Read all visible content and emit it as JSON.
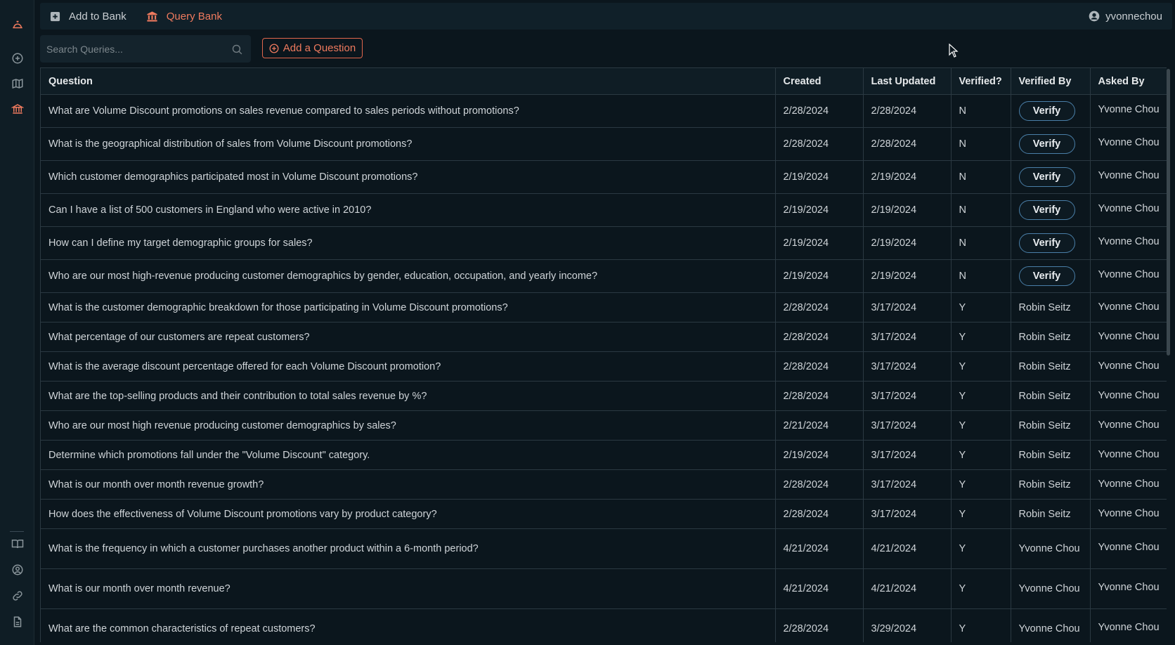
{
  "sidebar": {
    "icons": [
      "logo-icon",
      "plus-circle-icon",
      "map-icon",
      "bank-icon",
      "book-icon",
      "user-circle-icon",
      "link-icon",
      "document-icon"
    ]
  },
  "topbar": {
    "add_to_bank": "Add to Bank",
    "query_bank": "Query Bank",
    "username": "yvonnechou"
  },
  "search": {
    "placeholder": "Search Queries..."
  },
  "add_question_label": "Add a Question",
  "colors": {
    "accent": "#ef7a5e",
    "verify_border": "#4a7fa8",
    "background": "#0b161d"
  },
  "table": {
    "headers": {
      "question": "Question",
      "created": "Created",
      "last_updated": "Last Updated",
      "verified": "Verified?",
      "verified_by": "Verified By",
      "asked_by": "Asked By"
    },
    "verify_label": "Verify",
    "rows": [
      {
        "question": "What are Volume Discount promotions on sales revenue compared to sales periods without promotions?",
        "created": "2/28/2024",
        "last_updated": "2/28/2024",
        "verified": "N",
        "verified_by": "",
        "asked_by": "Yvonne Chou"
      },
      {
        "question": "What is the geographical distribution of sales from Volume Discount promotions?",
        "created": "2/28/2024",
        "last_updated": "2/28/2024",
        "verified": "N",
        "verified_by": "",
        "asked_by": "Yvonne Chou"
      },
      {
        "question": "Which customer demographics participated most in Volume Discount promotions?",
        "created": "2/19/2024",
        "last_updated": "2/19/2024",
        "verified": "N",
        "verified_by": "",
        "asked_by": "Yvonne Chou"
      },
      {
        "question": "Can I have a list of 500 customers in England who were active in 2010?",
        "created": "2/19/2024",
        "last_updated": "2/19/2024",
        "verified": "N",
        "verified_by": "",
        "asked_by": "Yvonne Chou"
      },
      {
        "question": "How can I define my target demographic groups for sales?",
        "created": "2/19/2024",
        "last_updated": "2/19/2024",
        "verified": "N",
        "verified_by": "",
        "asked_by": "Yvonne Chou"
      },
      {
        "question": "Who are our most high-revenue producing customer demographics by gender, education, occupation, and yearly income?",
        "created": "2/19/2024",
        "last_updated": "2/19/2024",
        "verified": "N",
        "verified_by": "",
        "asked_by": "Yvonne Chou"
      },
      {
        "question": "What is the customer demographic breakdown for those participating in Volume Discount promotions?",
        "created": "2/28/2024",
        "last_updated": "3/17/2024",
        "verified": "Y",
        "verified_by": "Robin Seitz",
        "asked_by": "Yvonne Chou"
      },
      {
        "question": "What percentage of our customers are repeat customers?",
        "created": "2/28/2024",
        "last_updated": "3/17/2024",
        "verified": "Y",
        "verified_by": "Robin Seitz",
        "asked_by": "Yvonne Chou"
      },
      {
        "question": "What is the average discount percentage offered for each Volume Discount promotion?",
        "created": "2/28/2024",
        "last_updated": "3/17/2024",
        "verified": "Y",
        "verified_by": "Robin Seitz",
        "asked_by": "Yvonne Chou"
      },
      {
        "question": "What are the top-selling products and their contribution to total sales revenue by %?",
        "created": "2/28/2024",
        "last_updated": "3/17/2024",
        "verified": "Y",
        "verified_by": "Robin Seitz",
        "asked_by": "Yvonne Chou"
      },
      {
        "question": "Who are our most high revenue producing customer demographics by sales?",
        "created": "2/21/2024",
        "last_updated": "3/17/2024",
        "verified": "Y",
        "verified_by": "Robin Seitz",
        "asked_by": "Yvonne Chou"
      },
      {
        "question": "Determine which promotions fall under the \"Volume Discount\" category.",
        "created": "2/19/2024",
        "last_updated": "3/17/2024",
        "verified": "Y",
        "verified_by": "Robin Seitz",
        "asked_by": "Yvonne Chou"
      },
      {
        "question": "What is our month over month revenue growth?",
        "created": "2/28/2024",
        "last_updated": "3/17/2024",
        "verified": "Y",
        "verified_by": "Robin Seitz",
        "asked_by": "Yvonne Chou"
      },
      {
        "question": "How does the effectiveness of Volume Discount promotions vary by product category?",
        "created": "2/28/2024",
        "last_updated": "3/17/2024",
        "verified": "Y",
        "verified_by": "Robin Seitz",
        "asked_by": "Yvonne Chou"
      },
      {
        "question": "What is the frequency in which a customer purchases another product within a 6-month period?",
        "created": "4/21/2024",
        "last_updated": "4/21/2024",
        "verified": "Y",
        "verified_by": "Yvonne Chou",
        "asked_by": "Yvonne Chou"
      },
      {
        "question": "What is our month over month revenue?",
        "created": "4/21/2024",
        "last_updated": "4/21/2024",
        "verified": "Y",
        "verified_by": "Yvonne Chou",
        "asked_by": "Yvonne Chou"
      },
      {
        "question": "What are the common characteristics of repeat customers?",
        "created": "2/28/2024",
        "last_updated": "3/29/2024",
        "verified": "Y",
        "verified_by": "Yvonne Chou",
        "asked_by": "Yvonne Chou"
      }
    ]
  }
}
